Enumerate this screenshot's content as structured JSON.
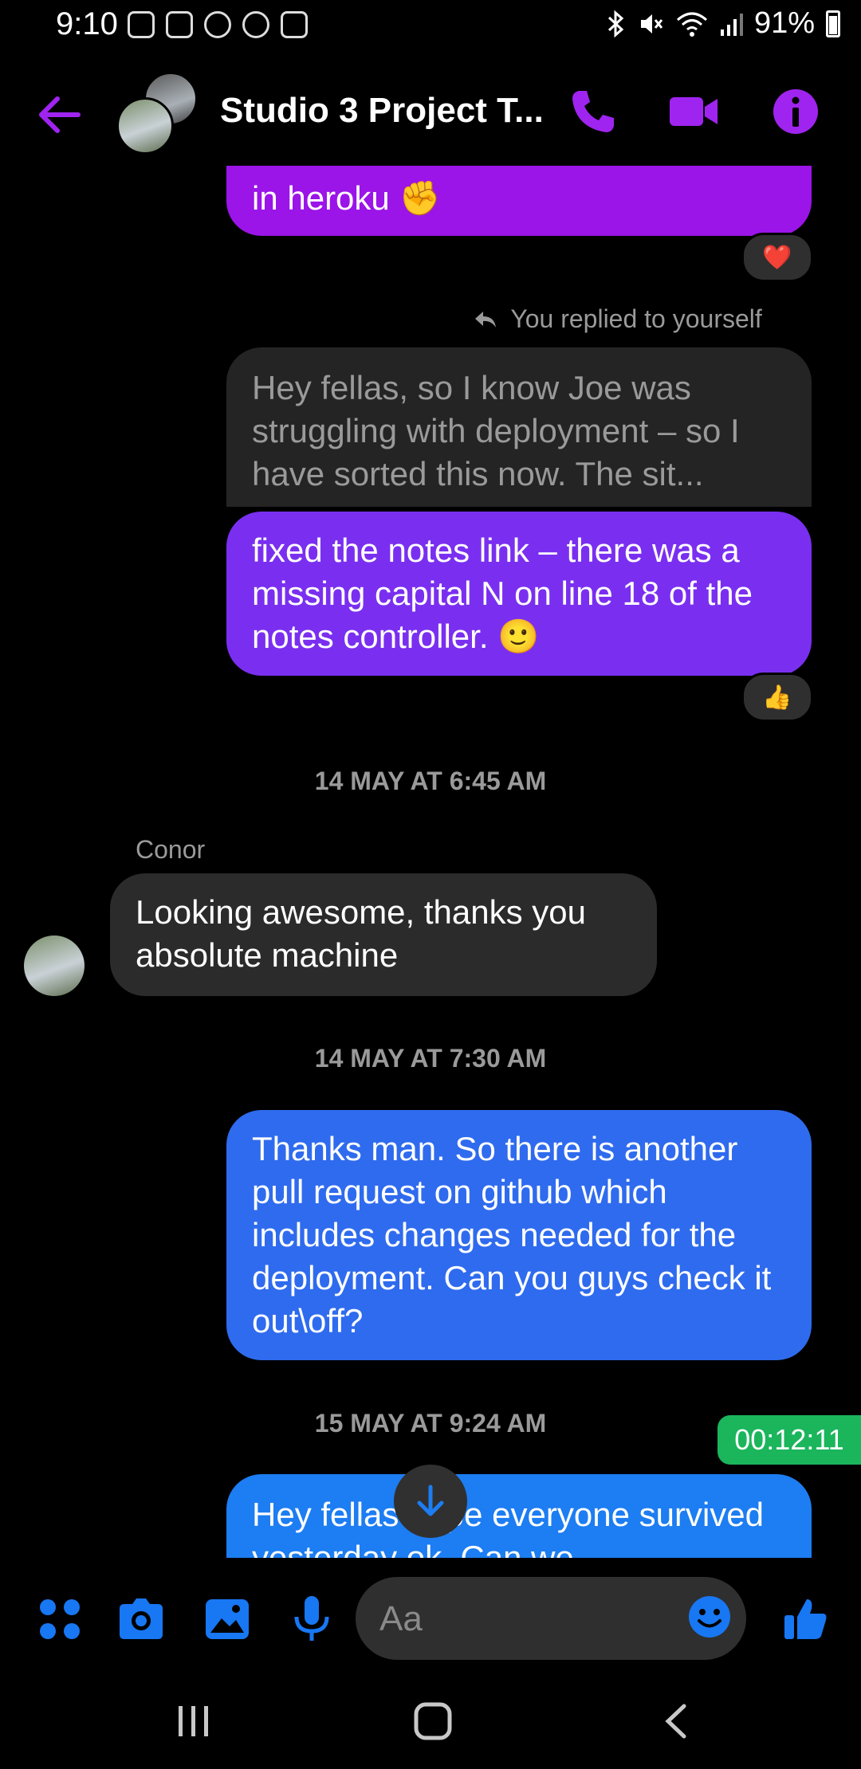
{
  "status_bar": {
    "time": "9:10",
    "battery": "91%"
  },
  "header": {
    "title": "Studio 3 Project T...",
    "accent": "#a024f0"
  },
  "messages": {
    "m1_text": "in heroku ✊",
    "m1_reaction": "❤️",
    "replied_label": "You replied to yourself",
    "quoted_text": "Hey fellas, so I know Joe was struggling with deployment – so I have sorted this now. The sit...",
    "m2_text": "fixed the notes link – there was a missing capital N on line 18 of the notes controller. 🙂",
    "m2_reaction": "👍",
    "date1": "14 MAY AT 6:45 AM",
    "sender_conor": "Conor",
    "m3_text": "Looking awesome, thanks you absolute machine",
    "date2": "14 MAY AT 7:30 AM",
    "m4_text": "Thanks man. So there is another pull request on github which includes changes needed for the deployment. Can you guys check it out\\off?",
    "date3": "15 MAY AT 9:24 AM",
    "m5_text": "Hey fellas hope everyone survived yesterday ok. Can we"
  },
  "timer": "00:12:11",
  "composer": {
    "placeholder": "Aa"
  },
  "colors": {
    "purple": "#9b14e8",
    "violet": "#7a2ff0",
    "blue": "#2f6bee",
    "bright_blue": "#1d7df2",
    "icon_blue": "#1877f2",
    "timer_green": "#1bb55c"
  }
}
